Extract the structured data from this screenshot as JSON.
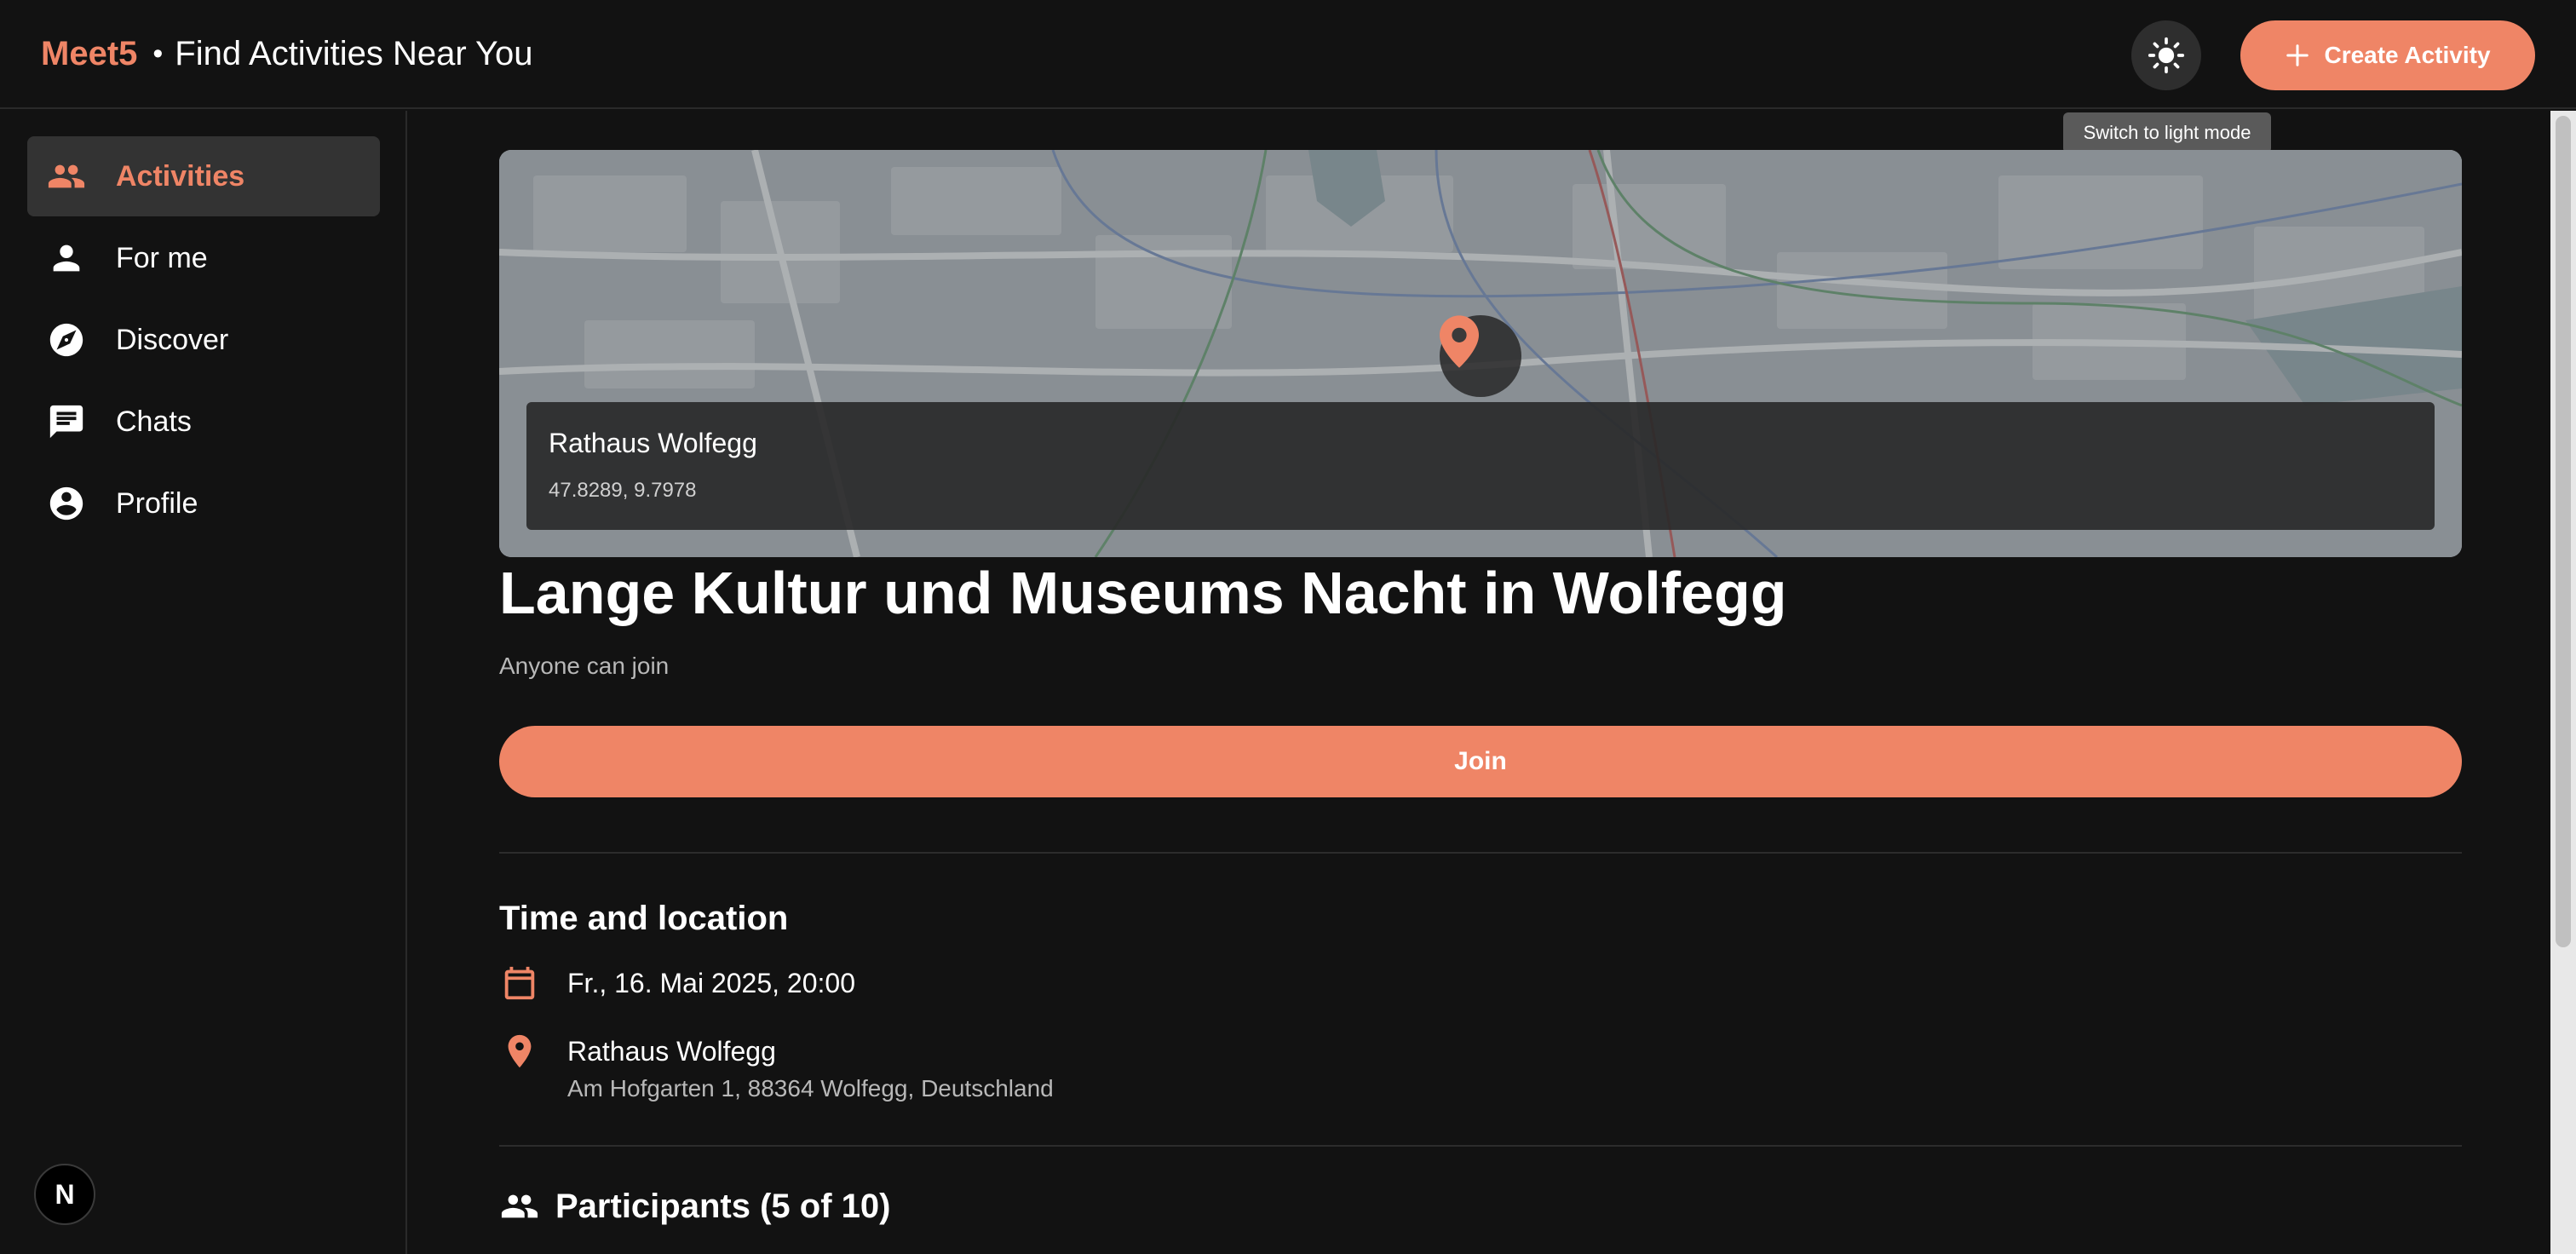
{
  "header": {
    "brand": "Meet5",
    "separator": "•",
    "subtitle": "Find Activities Near You",
    "theme_toggle_icon": "sun-icon",
    "theme_tooltip": "Switch to light mode",
    "create_label": "Create Activity",
    "create_icon": "plus-icon"
  },
  "sidebar": {
    "items": [
      {
        "label": "Activities",
        "icon": "group-icon",
        "active": true
      },
      {
        "label": "For me",
        "icon": "person-icon",
        "active": false
      },
      {
        "label": "Discover",
        "icon": "compass-icon",
        "active": false
      },
      {
        "label": "Chats",
        "icon": "chat-icon",
        "active": false
      },
      {
        "label": "Profile",
        "icon": "account-circle-icon",
        "active": false
      }
    ],
    "badge": "N"
  },
  "activity": {
    "map": {
      "place": "Rathaus Wolfegg",
      "coords": "47.8289, 9.7978",
      "pin_icon": "map-pin-icon"
    },
    "title": "Lange Kultur und Museums Nacht in Wolfegg",
    "access": "Anyone can join",
    "join_label": "Join",
    "time_location": {
      "heading": "Time and location",
      "datetime": "Fr., 16. Mai 2025, 20:00",
      "venue": "Rathaus Wolfegg",
      "address": "Am Hofgarten 1, 88364 Wolfegg, Deutschland"
    },
    "participants": {
      "heading": "Participants (5 of 10)"
    }
  },
  "colors": {
    "accent": "#ef8566",
    "background": "#121212",
    "active_nav_bg": "#333333",
    "muted_text": "#b8b8b8"
  }
}
